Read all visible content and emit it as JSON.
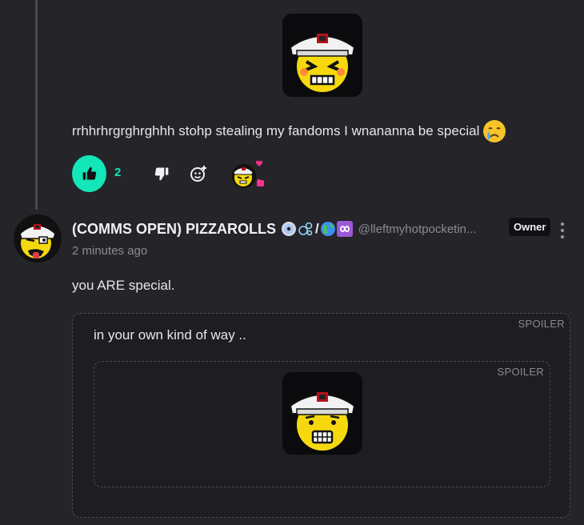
{
  "reply": {
    "message": "rrhhrhrgrghrghhh stohp stealing my fandoms I wnananna be special",
    "message_emoji": "crying-face-emoji",
    "like_count": "2",
    "liked": true
  },
  "comment": {
    "author_name": "(COMMS OPEN) PIZZAROLLS",
    "author_name_emojis": [
      "cd-emoji",
      "bubbles-emoji",
      "slash",
      "earth-emoji",
      "infinity-emoji"
    ],
    "author_handle": "@lleftmyhotpocketin...",
    "badge": "Owner",
    "timestamp": "2 minutes ago",
    "message": "you ARE special.",
    "spoiler_outer": {
      "label": "SPOILER",
      "text": "in your own kind of way .."
    },
    "spoiler_inner": {
      "label": "SPOILER"
    }
  },
  "colors": {
    "accent": "#13e6b8",
    "background": "#252429",
    "muted_text": "#8c8a93",
    "text": "#e8e6ee"
  }
}
